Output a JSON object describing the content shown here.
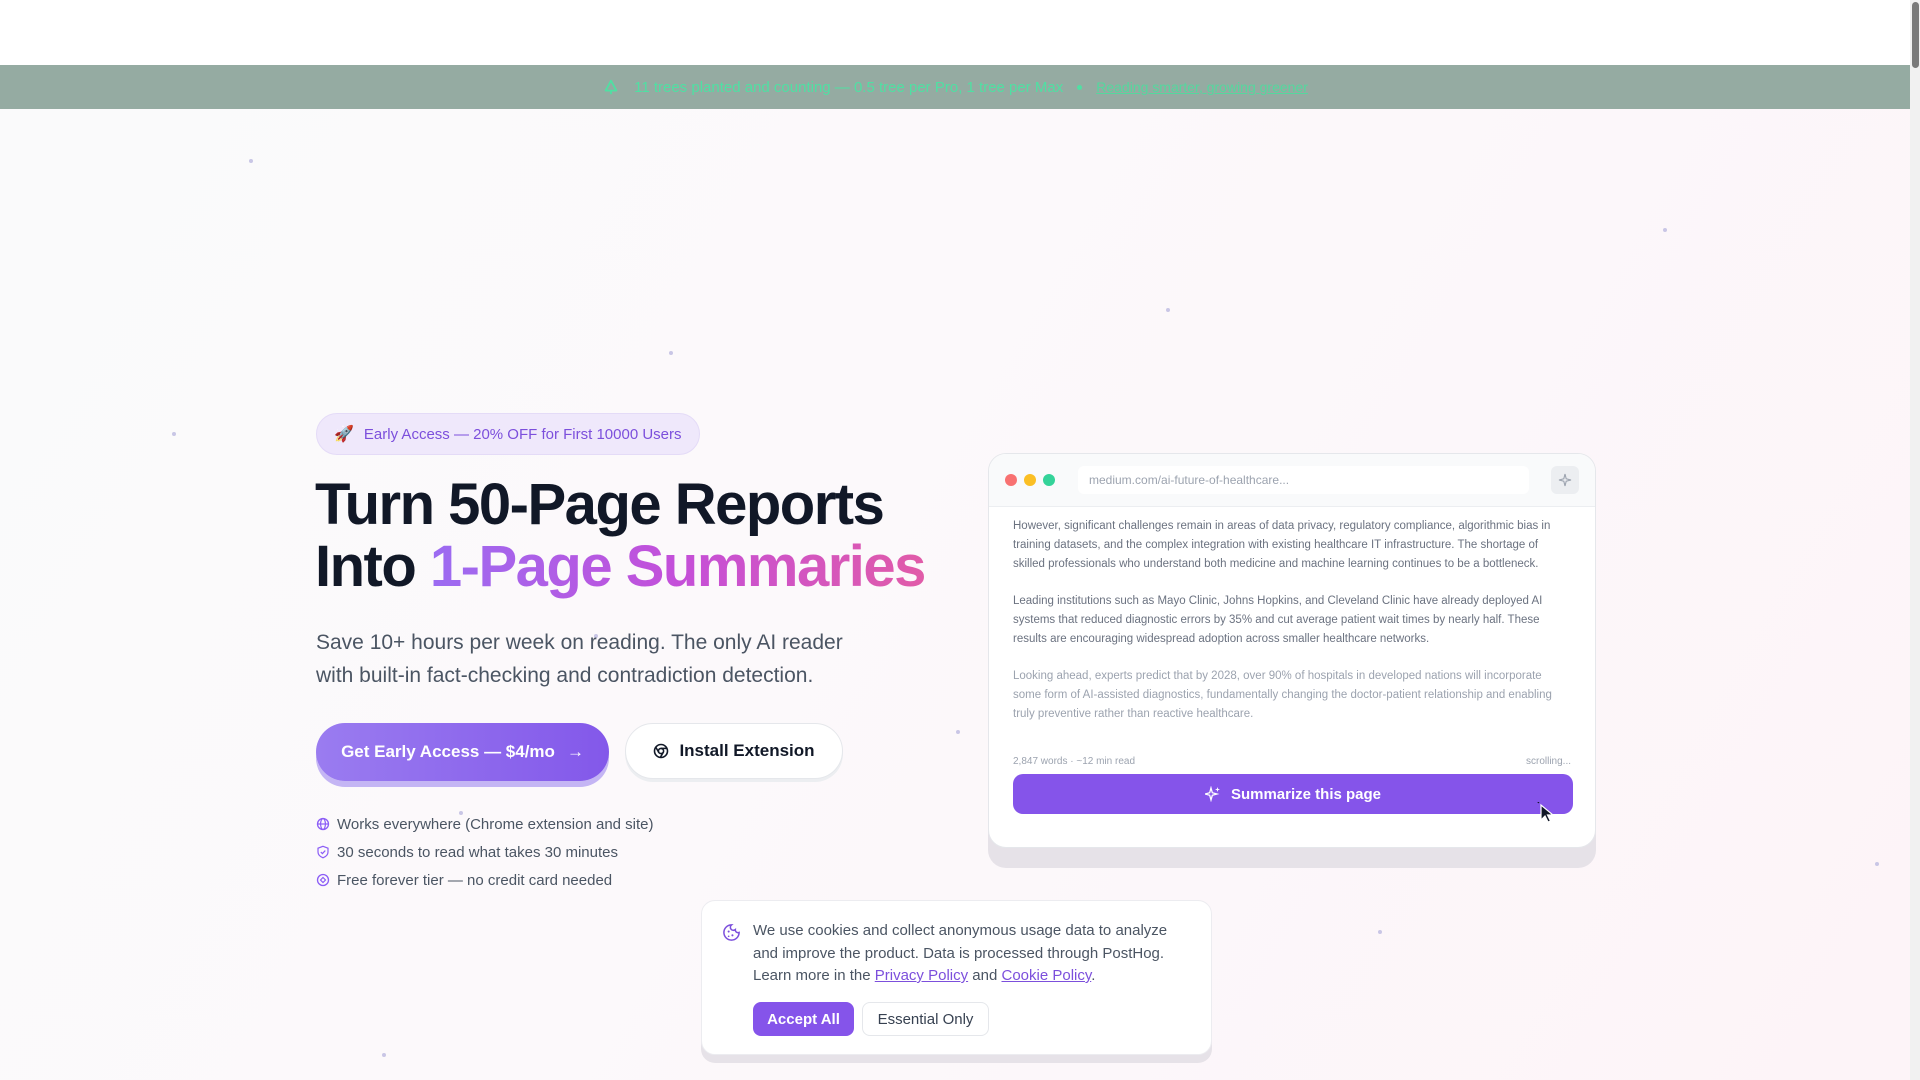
{
  "banner": {
    "text": "11 trees planted and counting — 0.5 tree per Pro, 1 tree per Max",
    "link": "Reading smarter, growing greener",
    "icon": "tree-icon"
  },
  "hero": {
    "badge_icon": "🚀",
    "badge": "Early Access — 20% OFF for First 10000 Users",
    "title_line1": "Turn 50-Page Reports",
    "title_line2_plain": "Into ",
    "title_line2_gradient": "1-Page Summaries",
    "subtitle": "Save 10+ hours per week on reading. The only AI reader with built-in fact-checking and contradiction detection.",
    "cta_primary": "Get Early Access — $4/mo",
    "cta_primary_arrow": "→",
    "cta_secondary": "Install Extension",
    "features": [
      "Works everywhere (Chrome extension and site)",
      "30 seconds to read what takes 30 minutes",
      "Free forever tier — no credit card needed"
    ]
  },
  "mockup": {
    "url": "medium.com/ai-future-of-healthcare...",
    "paragraphs": [
      "However, significant challenges remain in areas of data privacy, regulatory compliance, algorithmic bias in training datasets, and the complex integration with existing healthcare IT infrastructure. The shortage of skilled professionals who understand both medicine and machine learning continues to be a bottleneck.",
      "Leading institutions such as Mayo Clinic, Johns Hopkins, and Cleveland Clinic have already deployed AI systems that reduced diagnostic errors by 35% and cut average patient wait times by nearly half. These results are encouraging widespread adoption across smaller healthcare networks.",
      "Looking ahead, experts predict that by 2028, over 90% of hospitals in developed nations will incorporate some form of AI-assisted diagnostics, fundamentally changing the doctor-patient relationship and enabling truly preventive rather than reactive healthcare."
    ],
    "meta_left": "2,847 words · ~12 min read",
    "meta_right": "scrolling...",
    "summarize_button": "Summarize this page"
  },
  "cookie": {
    "text_before": "We use cookies and collect anonymous usage data to analyze and improve the product. Data is processed through PostHog. Learn more in the ",
    "privacy_link": "Privacy Policy",
    "and": " and ",
    "cookie_link": "Cookie Policy",
    "period": ".",
    "accept": "Accept All",
    "essential": "Essential Only"
  },
  "colors": {
    "accent": "#8554ea",
    "banner_bg": "#95aba2",
    "banner_text": "#4fe0a3",
    "traffic_red": "#f87171",
    "traffic_yellow": "#fbbf24",
    "traffic_green": "#34d399"
  }
}
